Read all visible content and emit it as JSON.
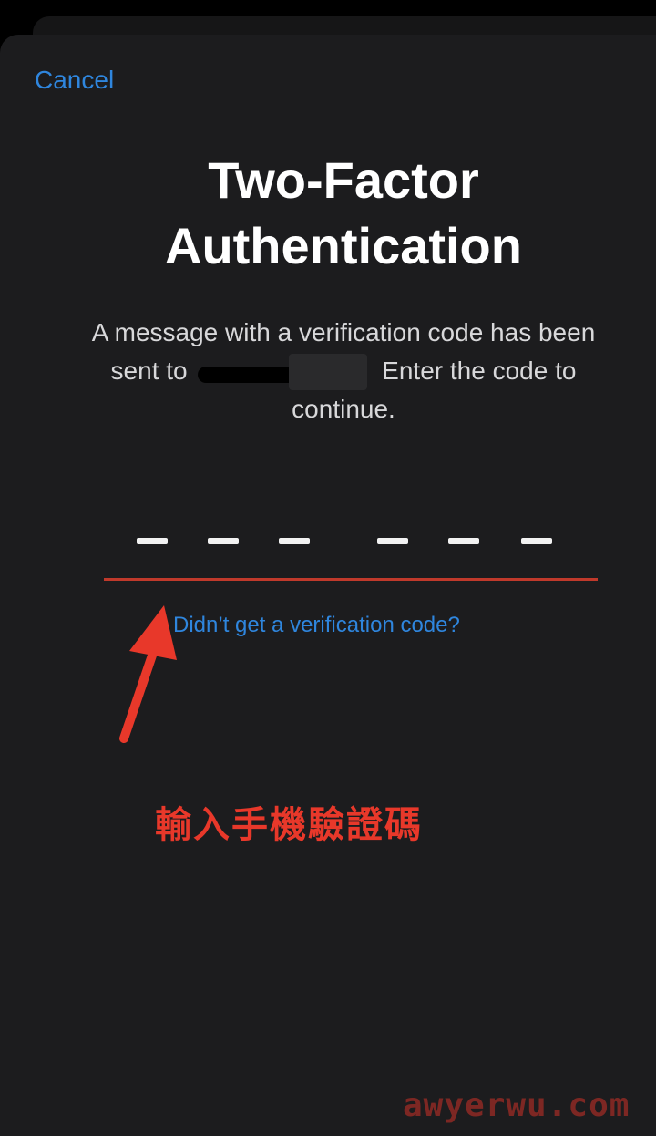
{
  "nav": {
    "cancel_label": "Cancel"
  },
  "title": {
    "line1": "Two-Factor",
    "line2": "Authentication"
  },
  "message": {
    "line1": "A message with a verification code has been",
    "line2_prefix": "sent to",
    "line2_suffix": "Enter the code to",
    "line3": "continue."
  },
  "code": {
    "slots": 6,
    "digits": [
      "",
      "",
      "",
      "",
      "",
      ""
    ]
  },
  "resend_label": "Didn’t get a verification code?",
  "annotation": {
    "text": "輸入手機驗證碼",
    "color": "#e8382a"
  },
  "watermark": "awyerwu.com",
  "colors": {
    "accent": "#2f86de",
    "sheet": "#1c1c1e",
    "underline": "#c0392b"
  }
}
